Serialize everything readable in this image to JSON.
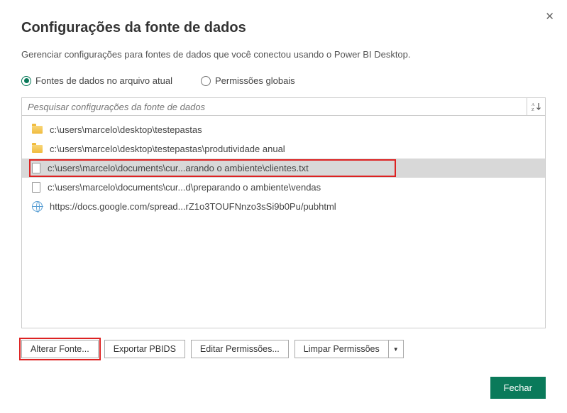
{
  "title": "Configurações da fonte de dados",
  "subtitle": "Gerenciar configurações para fontes de dados que você conectou usando o Power BI Desktop.",
  "radios": {
    "current_file": "Fontes de dados no arquivo atual",
    "global_perms": "Permissões globais"
  },
  "search": {
    "placeholder": "Pesquisar configurações da fonte de dados"
  },
  "items": [
    {
      "icon": "folder",
      "path": "c:\\users\\marcelo\\desktop\\testepastas",
      "selected": false,
      "highlight": false
    },
    {
      "icon": "folder",
      "path": "c:\\users\\marcelo\\desktop\\testepastas\\produtividade anual",
      "selected": false,
      "highlight": false
    },
    {
      "icon": "doc",
      "path": "c:\\users\\marcelo\\documents\\cur...arando o ambiente\\clientes.txt",
      "selected": true,
      "highlight": true
    },
    {
      "icon": "doc",
      "path": "c:\\users\\marcelo\\documents\\cur...d\\preparando o ambiente\\vendas",
      "selected": false,
      "highlight": false
    },
    {
      "icon": "globe",
      "path": "https://docs.google.com/spread...rZ1o3TOUFNnzo3sSi9b0Pu/pubhtml",
      "selected": false,
      "highlight": false
    }
  ],
  "buttons": {
    "change_source": "Alterar Fonte...",
    "export_pbids": "Exportar PBIDS",
    "edit_perms": "Editar Permissões...",
    "clear_perms": "Limpar Permissões",
    "close": "Fechar"
  }
}
